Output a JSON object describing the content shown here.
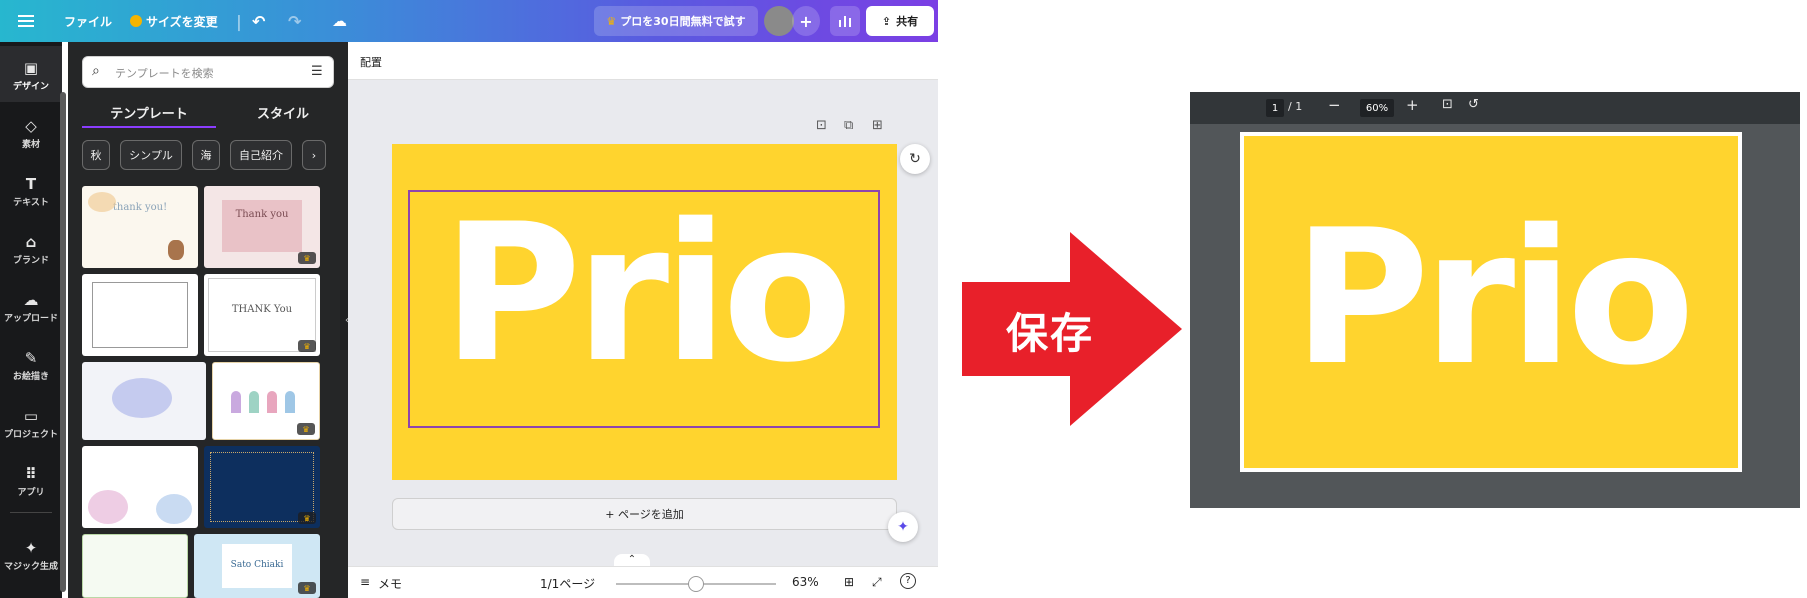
{
  "topbar": {
    "menu_icon": "menu-icon",
    "file_label": "ファイル",
    "resize_label": "サイズを変更",
    "pro_trial_label": "プロを30日間無料で試す",
    "share_label": "共有"
  },
  "rail": {
    "items": [
      {
        "label": "デザイン",
        "icon": "design-icon"
      },
      {
        "label": "素材",
        "icon": "elements-icon"
      },
      {
        "label": "テキスト",
        "icon": "text-icon"
      },
      {
        "label": "ブランド",
        "icon": "brand-icon"
      },
      {
        "label": "アップロード",
        "icon": "upload-icon"
      },
      {
        "label": "お絵描き",
        "icon": "draw-icon"
      },
      {
        "label": "プロジェクト",
        "icon": "folder-icon"
      },
      {
        "label": "アプリ",
        "icon": "apps-icon"
      },
      {
        "label": "マジック生成",
        "icon": "magic-icon"
      }
    ]
  },
  "panel": {
    "search_placeholder": "テンプレートを検索",
    "tab_templates": "テンプレート",
    "tab_styles": "スタイル",
    "chips": [
      "秋",
      "シンプル",
      "海",
      "自己紹介"
    ],
    "thumbs": {
      "t1": "thank you!",
      "t2": "Thank you",
      "t4": "THANK You",
      "t8": "Sato Chiaki"
    }
  },
  "workspace": {
    "header_label": "配置",
    "canvas_text": "Prio",
    "add_page_label": "+ ページを追加",
    "notes_label": "メモ",
    "page_count": "1/1ページ",
    "zoom_label": "63%",
    "zoom_fraction": 0.63
  },
  "arrow": {
    "label": "保存",
    "color": "#e8202a"
  },
  "viewer": {
    "page_current": "1",
    "page_total": "/ 1",
    "zoom": "60%",
    "page_text": "Prio"
  },
  "colors": {
    "canvas_yellow": "#ffd42e",
    "accent_purple": "#8b3dff",
    "viewer_bg": "#525659"
  }
}
